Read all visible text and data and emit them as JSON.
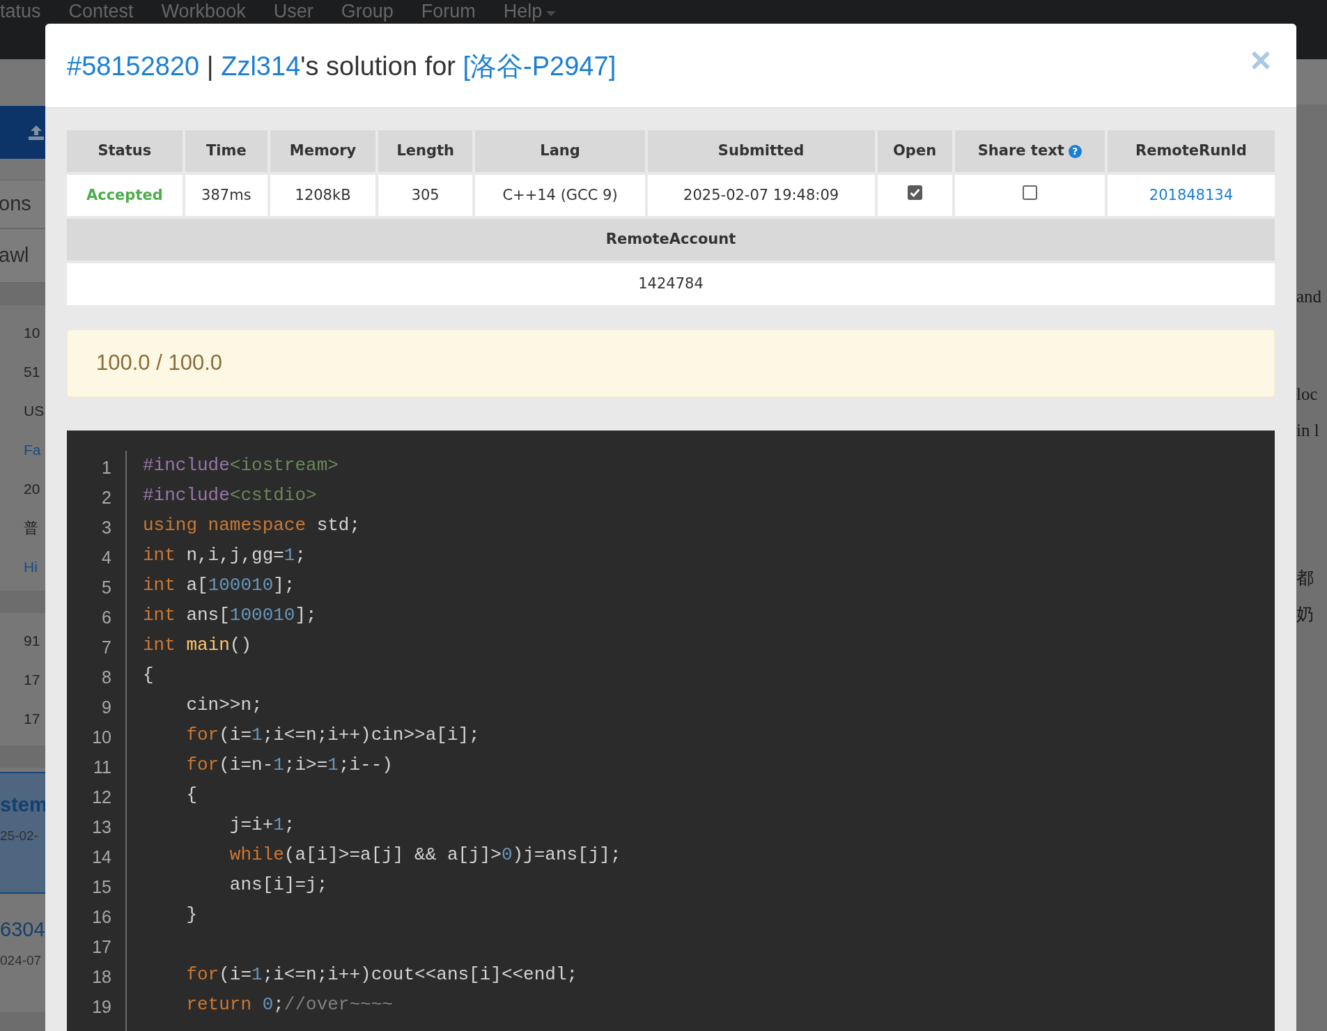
{
  "background": {
    "nav": [
      "tatus",
      "Contest",
      "Workbook",
      "User",
      "Group",
      "Forum",
      "Help"
    ],
    "left": [
      {
        "kind": "upload"
      },
      {
        "kind": "tab",
        "text": "ons"
      },
      {
        "kind": "tab",
        "text": "awl"
      },
      {
        "kind": "band"
      },
      {
        "kind": "item",
        "text": "10"
      },
      {
        "kind": "item",
        "text": "51"
      },
      {
        "kind": "item",
        "text": "US"
      },
      {
        "kind": "link",
        "text": "Fa"
      },
      {
        "kind": "item",
        "text": "20"
      },
      {
        "kind": "item",
        "text": "普"
      },
      {
        "kind": "link",
        "text": "Hi"
      },
      {
        "kind": "band"
      },
      {
        "kind": "item",
        "text": "91"
      },
      {
        "kind": "item",
        "text": "17"
      },
      {
        "kind": "item",
        "text": "17"
      },
      {
        "kind": "band"
      },
      {
        "kind": "card",
        "title": "stem",
        "sub": "25-02-"
      },
      {
        "kind": "entry",
        "title": "6304",
        "sub": "024-07"
      },
      {
        "kind": "band"
      }
    ],
    "right": [
      [
        "and"
      ],
      [
        "loc",
        "in l"
      ],
      [
        "都",
        "奶"
      ]
    ]
  },
  "modal": {
    "title": {
      "run_id": "#58152820",
      "separator": "|",
      "user": "Zzl314",
      "middle": "'s solution for",
      "problem": "[洛谷-P2947]"
    },
    "close": "×",
    "table": {
      "columns": [
        {
          "label": "Status"
        },
        {
          "label": "Time"
        },
        {
          "label": "Memory"
        },
        {
          "label": "Length"
        },
        {
          "label": "Lang"
        },
        {
          "label": "Submitted"
        },
        {
          "label": "Open"
        },
        {
          "label": "Share text",
          "help": "?"
        },
        {
          "label": "RemoteRunId"
        }
      ],
      "row": [
        {
          "kind": "verdict",
          "text": "Accepted"
        },
        {
          "kind": "text",
          "text": "387ms"
        },
        {
          "kind": "text",
          "text": "1208kB"
        },
        {
          "kind": "text",
          "text": "305"
        },
        {
          "kind": "text",
          "text": "C++14 (GCC 9)"
        },
        {
          "kind": "text",
          "text": "2025-02-07 19:48:09"
        },
        {
          "kind": "checkbox",
          "checked": true
        },
        {
          "kind": "checkbox",
          "checked": false
        },
        {
          "kind": "link",
          "text": "201848134"
        }
      ]
    },
    "extra": {
      "column": "RemoteAccount",
      "value": "1424784"
    },
    "score": "100.0 / 100.0",
    "code": [
      {
        "number": "1",
        "tokens": [
          {
            "kind": "preproc",
            "text": "#include"
          },
          {
            "kind": "string",
            "text": "<iostream>"
          }
        ]
      },
      {
        "number": "2",
        "tokens": [
          {
            "kind": "preproc",
            "text": "#include"
          },
          {
            "kind": "string",
            "text": "<cstdio>"
          }
        ]
      },
      {
        "number": "3",
        "tokens": [
          {
            "kind": "keyword",
            "text": "using namespace"
          },
          {
            "kind": "plain",
            "text": " std;"
          }
        ]
      },
      {
        "number": "4",
        "tokens": [
          {
            "kind": "keyword",
            "text": "int"
          },
          {
            "kind": "plain",
            "text": " n,i,j,gg="
          },
          {
            "kind": "number",
            "text": "1"
          },
          {
            "kind": "plain",
            "text": ";"
          }
        ]
      },
      {
        "number": "5",
        "tokens": [
          {
            "kind": "keyword",
            "text": "int"
          },
          {
            "kind": "plain",
            "text": " a["
          },
          {
            "kind": "number",
            "text": "100010"
          },
          {
            "kind": "plain",
            "text": "];"
          }
        ]
      },
      {
        "number": "6",
        "tokens": [
          {
            "kind": "keyword",
            "text": "int"
          },
          {
            "kind": "plain",
            "text": " ans["
          },
          {
            "kind": "number",
            "text": "100010"
          },
          {
            "kind": "plain",
            "text": "];"
          }
        ]
      },
      {
        "number": "7",
        "tokens": [
          {
            "kind": "keyword",
            "text": "int"
          },
          {
            "kind": "function",
            "text": " main"
          },
          {
            "kind": "plain",
            "text": "()"
          }
        ]
      },
      {
        "number": "8",
        "tokens": [
          {
            "kind": "plain",
            "text": "{"
          }
        ]
      },
      {
        "number": "9",
        "tokens": [
          {
            "kind": "plain",
            "text": "    cin>>n;"
          }
        ]
      },
      {
        "number": "10",
        "tokens": [
          {
            "kind": "keyword",
            "text": "    for"
          },
          {
            "kind": "plain",
            "text": "(i="
          },
          {
            "kind": "number",
            "text": "1"
          },
          {
            "kind": "plain",
            "text": ";i<=n;i++)cin>>a[i];"
          }
        ]
      },
      {
        "number": "11",
        "tokens": [
          {
            "kind": "keyword",
            "text": "    for"
          },
          {
            "kind": "plain",
            "text": "(i=n-"
          },
          {
            "kind": "number",
            "text": "1"
          },
          {
            "kind": "plain",
            "text": ";i>="
          },
          {
            "kind": "number",
            "text": "1"
          },
          {
            "kind": "plain",
            "text": ";i--)"
          }
        ]
      },
      {
        "number": "12",
        "tokens": [
          {
            "kind": "plain",
            "text": "    {"
          }
        ]
      },
      {
        "number": "13",
        "tokens": [
          {
            "kind": "plain",
            "text": "        j=i+"
          },
          {
            "kind": "number",
            "text": "1"
          },
          {
            "kind": "plain",
            "text": ";"
          }
        ]
      },
      {
        "number": "14",
        "tokens": [
          {
            "kind": "keyword",
            "text": "        while"
          },
          {
            "kind": "plain",
            "text": "(a[i]>=a[j] && a[j]>"
          },
          {
            "kind": "number",
            "text": "0"
          },
          {
            "kind": "plain",
            "text": ")j=ans[j];"
          }
        ]
      },
      {
        "number": "15",
        "tokens": [
          {
            "kind": "plain",
            "text": "        ans[i]=j;"
          }
        ]
      },
      {
        "number": "16",
        "tokens": [
          {
            "kind": "plain",
            "text": "    }"
          }
        ]
      },
      {
        "number": "17"
      },
      {
        "number": "18",
        "tokens": [
          {
            "kind": "keyword",
            "text": "    for"
          },
          {
            "kind": "plain",
            "text": "(i="
          },
          {
            "kind": "number",
            "text": "1"
          },
          {
            "kind": "plain",
            "text": ";i<=n;i++)cout<<ans[i]<<endl;"
          }
        ]
      },
      {
        "number": "19",
        "tokens": [
          {
            "kind": "keyword",
            "text": "    return"
          },
          {
            "kind": "number",
            "text": " 0"
          },
          {
            "kind": "plain",
            "text": ";"
          },
          {
            "kind": "comment",
            "text": "//over~~~~"
          }
        ]
      }
    ]
  }
}
